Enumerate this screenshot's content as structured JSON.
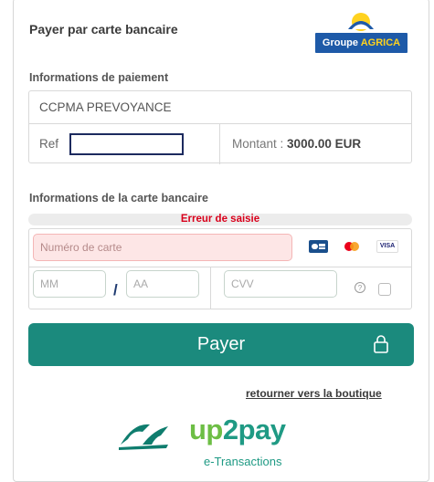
{
  "header": {
    "title": "Payer par carte bancaire",
    "logo_brand": "Groupe",
    "logo_brand_highlight": "AGRICA"
  },
  "payment_info": {
    "section_label": "Informations de paiement",
    "organization": "CCPMA PREVOYANCE",
    "ref_label": "Ref",
    "ref_value": "",
    "amount_label": "Montant : ",
    "amount_value": "3000.00 EUR"
  },
  "card_info": {
    "section_label": "Informations de la carte bancaire",
    "error_message": "Erreur de saisie",
    "card_number_placeholder": "Numéro de carte",
    "month_placeholder": "MM",
    "separator": "/",
    "year_placeholder": "AA",
    "cvv_placeholder": "CVV",
    "card_brands": [
      "CB",
      "Mastercard",
      "VISA"
    ],
    "help_symbol": "?"
  },
  "actions": {
    "pay_label": "Payer",
    "return_label": "retourner vers la boutique"
  },
  "footer": {
    "brand_up": "up",
    "brand_rest": "2pay",
    "tagline": "e-Transactions"
  },
  "colors": {
    "accent": "#1b8a7d",
    "error": "#d9001b",
    "agrica_blue": "#1e5aa8",
    "agrica_yellow": "#ffd21f"
  }
}
